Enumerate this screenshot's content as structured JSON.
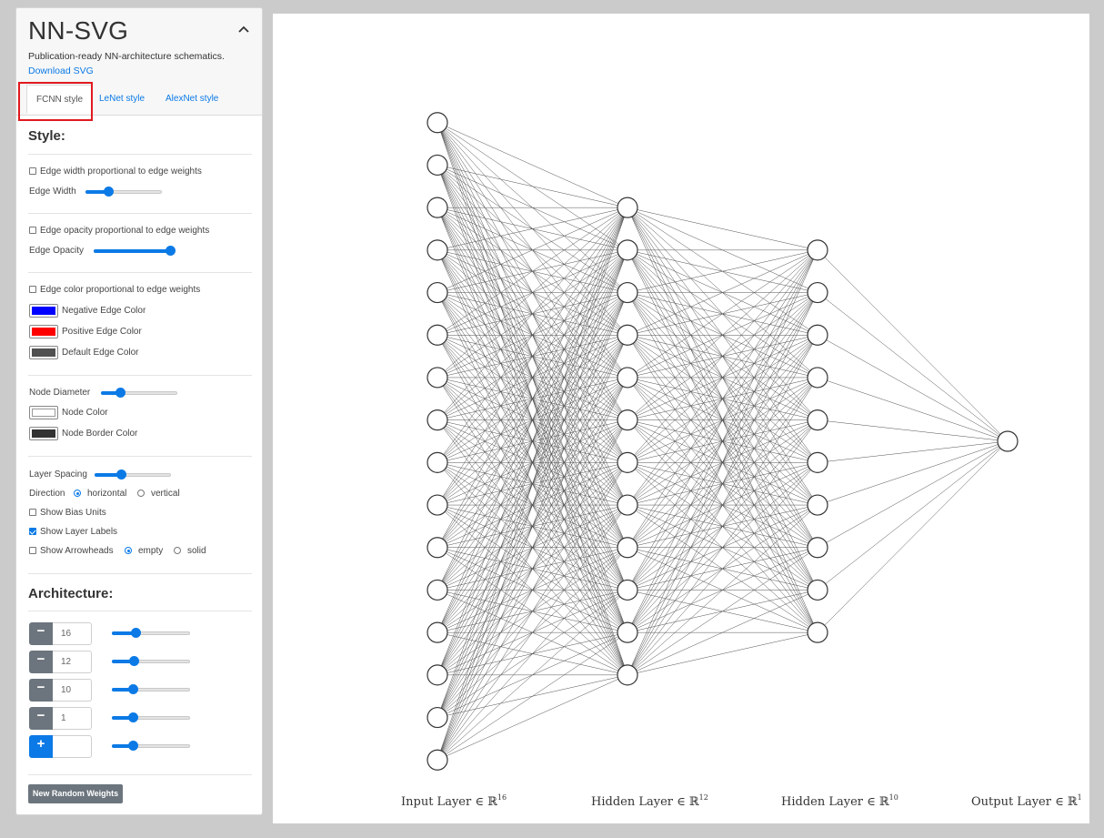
{
  "app": {
    "title": "NN-SVG",
    "subtitle": "Publication-ready NN-architecture schematics.",
    "download_link": "Download SVG",
    "collapse_icon": "chevron-up-icon"
  },
  "tabs": [
    {
      "label": "FCNN style",
      "active": true
    },
    {
      "label": "LeNet style",
      "active": false
    },
    {
      "label": "AlexNet style",
      "active": false
    }
  ],
  "style_section": {
    "title": "Style:",
    "edge_width_proportional": {
      "label": "Edge width proportional to edge weights",
      "checked": false
    },
    "edge_width": {
      "label": "Edge Width",
      "value": 0.3
    },
    "edge_opacity_proportional": {
      "label": "Edge opacity proportional to edge weights",
      "checked": false
    },
    "edge_opacity": {
      "label": "Edge Opacity",
      "value": 1.0
    },
    "edge_color_proportional": {
      "label": "Edge color proportional to edge weights",
      "checked": false
    },
    "negative_edge_color": {
      "label": "Negative Edge Color",
      "color": "#0000ff"
    },
    "positive_edge_color": {
      "label": "Positive Edge Color",
      "color": "#ff0000"
    },
    "default_edge_color": {
      "label": "Default Edge Color",
      "color": "#505050"
    },
    "node_diameter": {
      "label": "Node Diameter",
      "value": 0.25
    },
    "node_color": {
      "label": "Node Color",
      "color": "#ffffff"
    },
    "node_border_color": {
      "label": "Node Border Color",
      "color": "#333333"
    },
    "layer_spacing": {
      "label": "Layer Spacing",
      "value": 0.35
    },
    "direction": {
      "label": "Direction",
      "options": [
        "horizontal",
        "vertical"
      ],
      "selected": "horizontal"
    },
    "show_bias_units": {
      "label": "Show Bias Units",
      "checked": false
    },
    "show_layer_labels": {
      "label": "Show Layer Labels",
      "checked": true
    },
    "show_arrowheads": {
      "label": "Show Arrowheads",
      "checked": false,
      "options": [
        "empty",
        "solid"
      ],
      "selected": "empty"
    }
  },
  "architecture_section": {
    "title": "Architecture:",
    "layers": [
      {
        "value": "16",
        "slider": 0.3
      },
      {
        "value": "12",
        "slider": 0.28
      },
      {
        "value": "10",
        "slider": 0.27
      },
      {
        "value": "1",
        "slider": 0.27
      }
    ],
    "add_slider": 0.27,
    "random_button": "New Random Weights"
  },
  "network": {
    "layers": [
      16,
      12,
      10,
      1
    ],
    "labels": [
      {
        "text": "Input Layer ∈ ℝ",
        "sup": "16"
      },
      {
        "text": "Hidden Layer ∈ ℝ",
        "sup": "12"
      },
      {
        "text": "Hidden Layer ∈ ℝ",
        "sup": "10"
      },
      {
        "text": "Output Layer ∈ ℝ",
        "sup": "1"
      }
    ],
    "edge_color": "#505050",
    "node_fill": "#ffffff",
    "node_stroke": "#333333"
  }
}
